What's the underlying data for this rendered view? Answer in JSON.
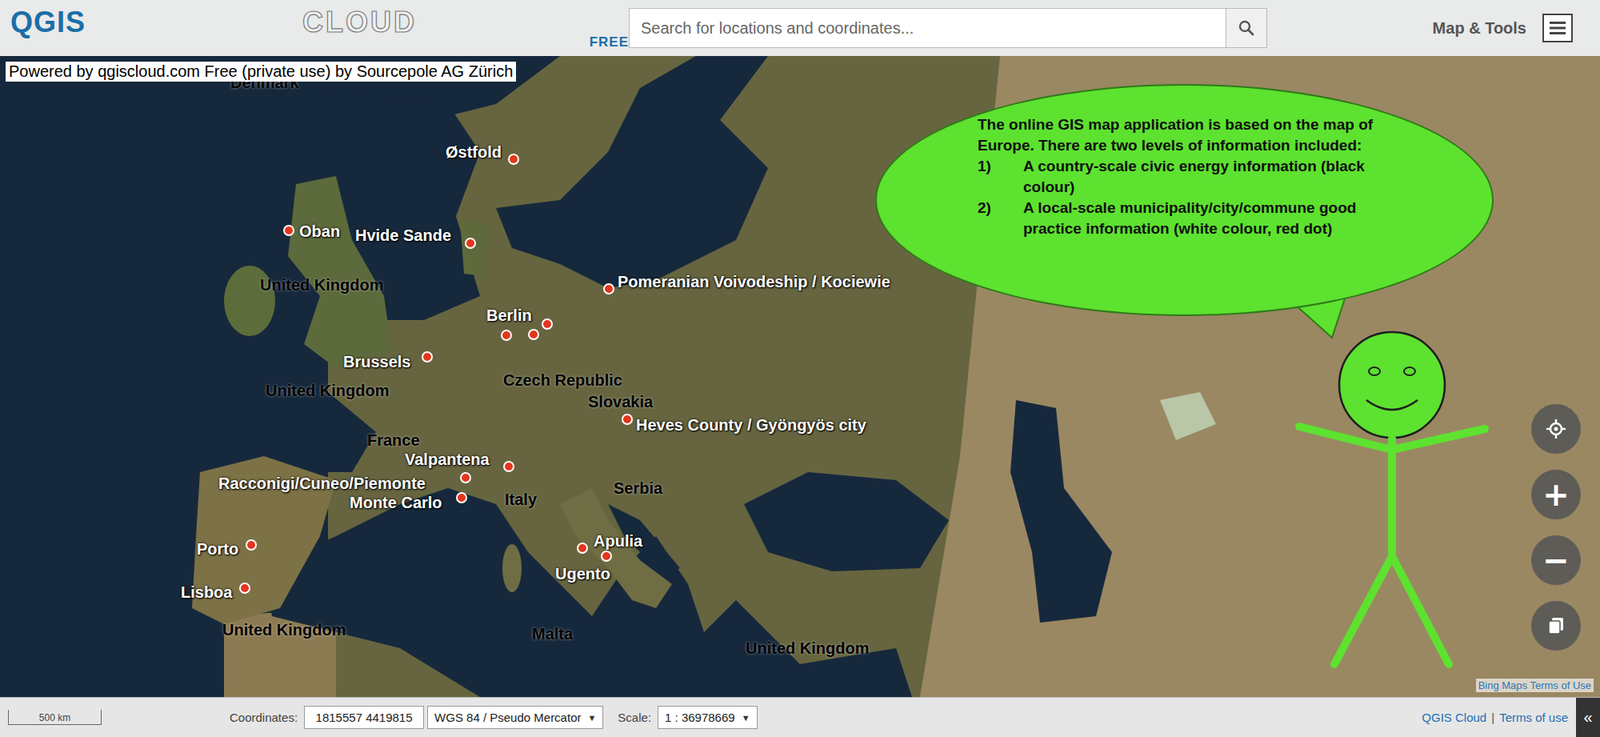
{
  "header": {
    "logo": {
      "main": "QGIS",
      "second": "CLOUD",
      "badge": "FREE"
    },
    "search": {
      "placeholder": "Search for locations and coordinates..."
    },
    "menu_label": "Map & Tools"
  },
  "attribution": "Powered by qgiscloud.com Free (private use) by Sourcepole AG Zürich",
  "map": {
    "country_labels": [
      "Denmark",
      "United Kingdom",
      "United Kingdom",
      "Czech Republic",
      "Slovakia",
      "France",
      "Italy",
      "Serbia",
      "Malta",
      "United Kingdom",
      "United Kingdom"
    ],
    "places": [
      {
        "name": "Østfold"
      },
      {
        "name": "Oban"
      },
      {
        "name": "Hvide Sande"
      },
      {
        "name": "Pomeranian Voivodeship / Kociewie"
      },
      {
        "name": "Berlin"
      },
      {
        "name": "Brussels"
      },
      {
        "name": "Heves County / Gyöngyös city"
      },
      {
        "name": "Valpantena"
      },
      {
        "name": "Racconigi/Cuneo/Piemonte"
      },
      {
        "name": "Monte Carlo"
      },
      {
        "name": "Apulia"
      },
      {
        "name": "Ugento"
      },
      {
        "name": "Porto"
      },
      {
        "name": "Lisboa"
      }
    ]
  },
  "bubble": {
    "intro": "The online GIS map application is based on the map of Europe. There are two levels of information included:",
    "items": [
      {
        "number": "1)",
        "text": "A country-scale civic energy information (black colour)"
      },
      {
        "number": "2)",
        "text": "A local-scale municipality/city/commune good practice information (white colour, red dot)"
      }
    ]
  },
  "map_controls": {
    "zoom_in": "+",
    "zoom_out": "−"
  },
  "bing_terms": "Bing Maps Terms of Use",
  "footer": {
    "scale_bar": "500 km",
    "coordinates_label": "Coordinates:",
    "coordinates": "1815557 4419815",
    "crs": {
      "value": "WGS 84 / Pseudo Mercator",
      "arrow": "▼"
    },
    "scale_label": "Scale:",
    "scale": {
      "value": "1 : 36978669",
      "arrow": "▼"
    },
    "links": [
      "QGIS Cloud",
      "Terms of use"
    ],
    "separator": "|",
    "collapse": "«"
  }
}
